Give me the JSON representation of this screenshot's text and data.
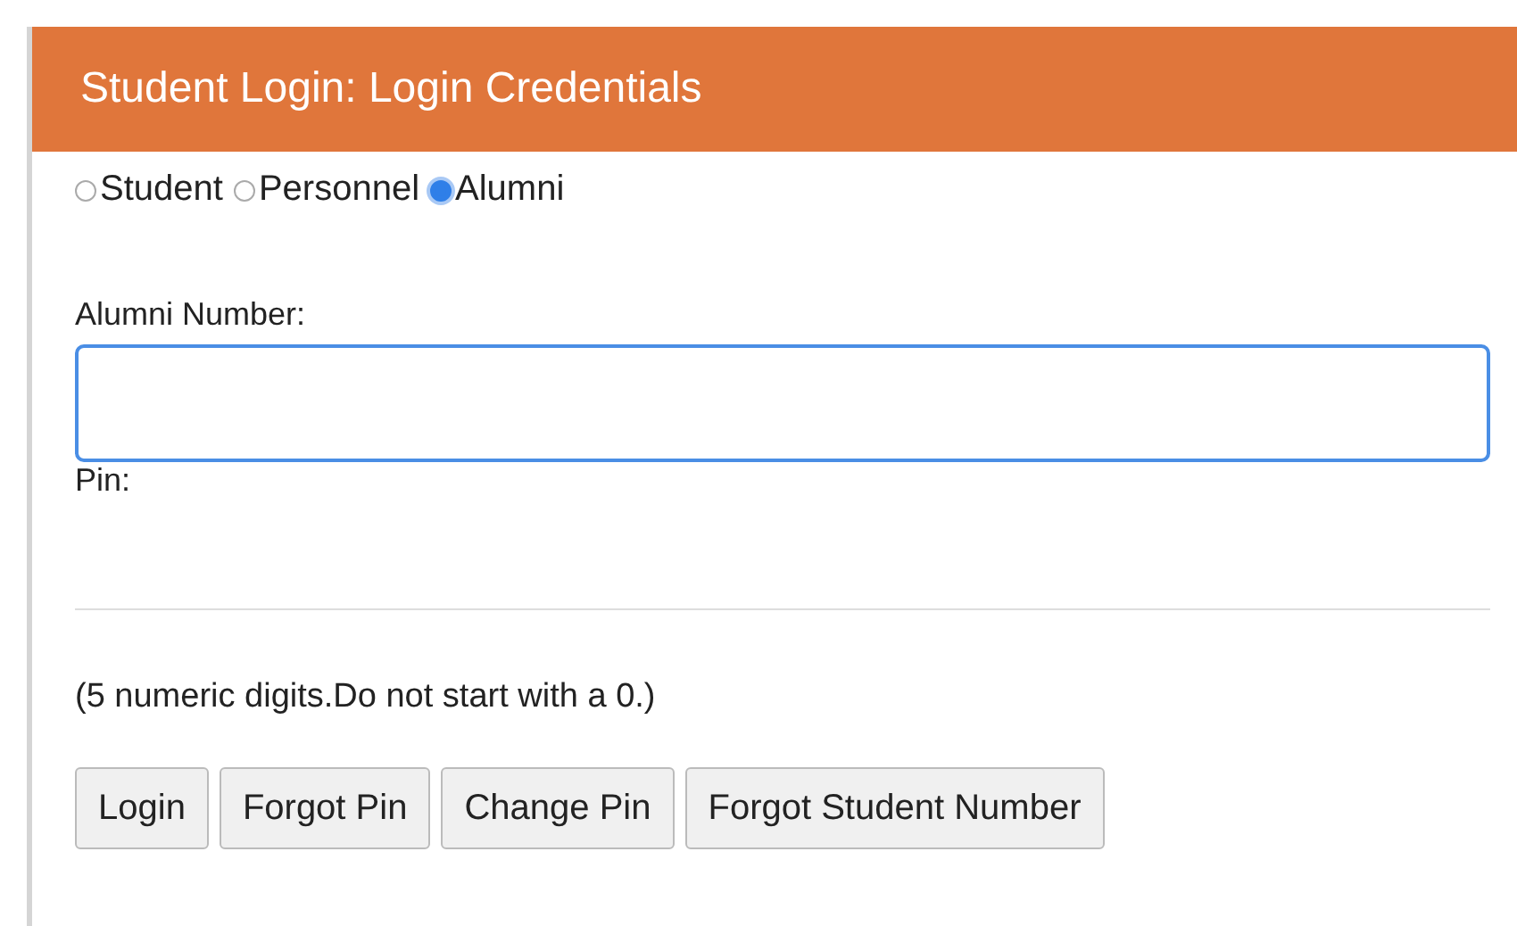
{
  "header": {
    "title": "Student Login: Login Credentials"
  },
  "account_types": [
    {
      "label": "Student",
      "selected": false
    },
    {
      "label": "Personnel",
      "selected": false
    },
    {
      "label": "Alumni",
      "selected": true
    }
  ],
  "number_field": {
    "label": "Alumni Number:",
    "focused": true
  },
  "pin_field": {
    "label": "Pin:"
  },
  "hint": "(5 numeric digits.Do not start with a 0.)",
  "buttons": [
    "Login",
    "Forgot Pin",
    "Change Pin",
    "Forgot Student Number"
  ]
}
